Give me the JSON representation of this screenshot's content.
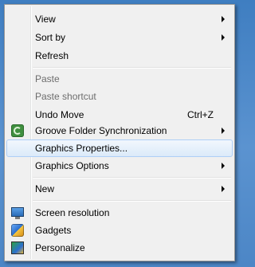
{
  "context_menu": {
    "items": [
      {
        "label": "View",
        "submenu": true,
        "disabled": false
      },
      {
        "label": "Sort by",
        "submenu": true,
        "disabled": false
      },
      {
        "label": "Refresh",
        "submenu": false,
        "disabled": false
      },
      {
        "label": "Paste",
        "submenu": false,
        "disabled": true
      },
      {
        "label": "Paste shortcut",
        "submenu": false,
        "disabled": true
      },
      {
        "label": "Undo Move",
        "shortcut": "Ctrl+Z",
        "submenu": false,
        "disabled": false
      },
      {
        "label": "Groove Folder Synchronization",
        "icon": "groove-sync-icon",
        "submenu": true,
        "disabled": false
      },
      {
        "label": "Graphics Properties...",
        "submenu": false,
        "disabled": false,
        "highlighted": true
      },
      {
        "label": "Graphics Options",
        "submenu": true,
        "disabled": false
      },
      {
        "label": "New",
        "submenu": true,
        "disabled": false
      },
      {
        "label": "Screen resolution",
        "icon": "screen-resolution-icon",
        "submenu": false,
        "disabled": false
      },
      {
        "label": "Gadgets",
        "icon": "gadgets-icon",
        "submenu": false,
        "disabled": false
      },
      {
        "label": "Personalize",
        "icon": "personalize-icon",
        "submenu": false,
        "disabled": false
      }
    ]
  },
  "colors": {
    "desktop": "#4c86c6",
    "menu_background": "#f0f0f0",
    "highlight_border": "#aecff7",
    "disabled_text": "#6d6d6d"
  }
}
